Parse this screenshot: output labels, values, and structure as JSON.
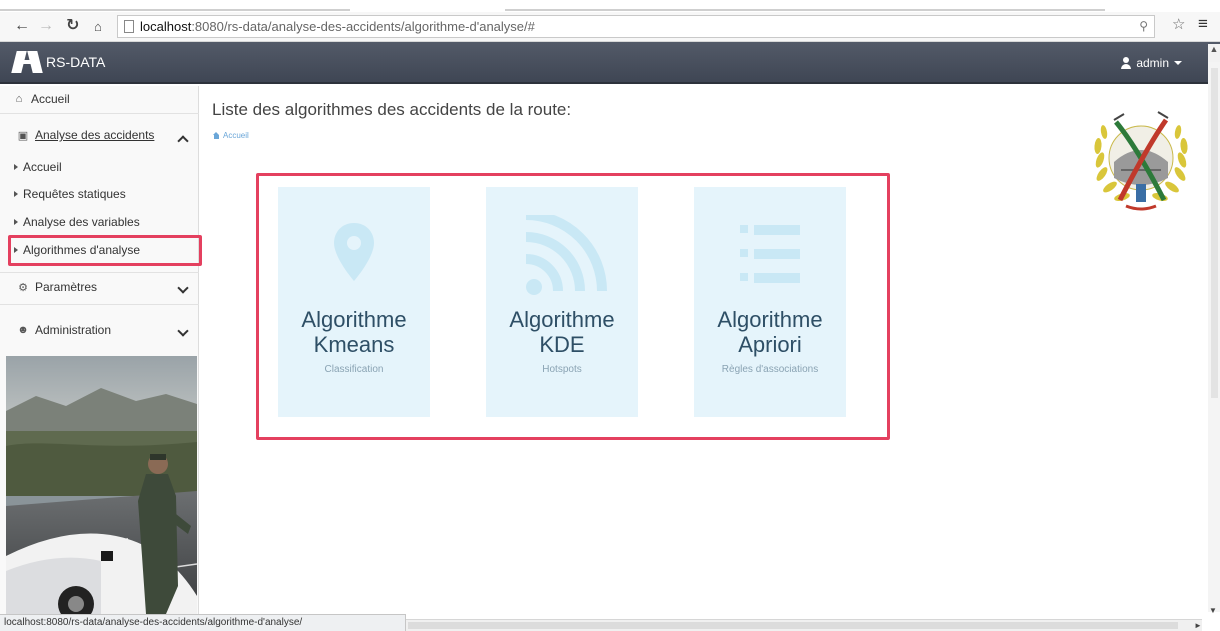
{
  "browser": {
    "url_host": "localhost",
    "url_path": ":8080/rs-data/analyse-des-accidents/algorithme-d'analyse/#",
    "back_icon": "arrow-left-icon",
    "forward_icon": "arrow-right-icon",
    "reload_icon": "reload-icon",
    "home_icon": "home-icon",
    "zoom_icon": "zoom-icon",
    "star_icon": "star-icon",
    "menu_icon": "hamburger-menu-icon",
    "status_url": "localhost:8080/rs-data/analyse-des-accidents/algorithme-d'analyse/"
  },
  "header": {
    "brand": "RS-DATA",
    "user": "admin"
  },
  "sidebar": {
    "top_items": [
      {
        "label": "Accueil",
        "icon": "home-icon"
      },
      {
        "label": "Analyse des accidents",
        "icon": "road-icon"
      },
      {
        "label": "Paramètres",
        "icon": "cogs-icon"
      },
      {
        "label": "Administration",
        "icon": "users-icon"
      }
    ],
    "sub_items": [
      {
        "label": "Accueil"
      },
      {
        "label": "Requêtes statiques"
      },
      {
        "label": "Analyse des variables"
      },
      {
        "label": "Algorithmes d'analyse"
      }
    ]
  },
  "main": {
    "title": "Liste des algorithmes des accidents de la route:",
    "breadcrumb": "Accueil",
    "cards": [
      {
        "line1": "Algorithme",
        "line2": "Kmeans",
        "sub": "Classification",
        "icon": "map-marker-icon"
      },
      {
        "line1": "Algorithme",
        "line2": "KDE",
        "sub": "Hotspots",
        "icon": "rss-feed-icon"
      },
      {
        "line1": "Algorithme",
        "line2": "Apriori",
        "sub": "Règles d'associations",
        "icon": "list-icon"
      }
    ]
  },
  "colors": {
    "accent_highlight": "#e4405f",
    "card_background": "#e5f4fb",
    "header_background": "#474e5c"
  }
}
